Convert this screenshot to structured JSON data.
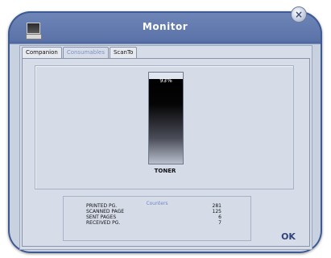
{
  "window": {
    "title": "Monitor",
    "close_symbol": "×"
  },
  "tabs": [
    {
      "label": "Companion",
      "active": false
    },
    {
      "label": "Consumables",
      "active": true
    },
    {
      "label": "ScanTo",
      "active": false
    }
  ],
  "toner": {
    "percent_text": "93%",
    "level": 0.93,
    "label": "TONER"
  },
  "counters": {
    "title": "Counters",
    "rows": [
      {
        "label": "PRINTED PG.",
        "value": "281"
      },
      {
        "label": "SCANNED PAGE",
        "value": "125"
      },
      {
        "label": "SENT PAGES",
        "value": "6"
      },
      {
        "label": "RECEIVED PG.",
        "value": "7"
      }
    ]
  },
  "ok_label": "OK",
  "colors": {
    "accent": "#6f84c6",
    "titlebar": "#5b73a8"
  }
}
